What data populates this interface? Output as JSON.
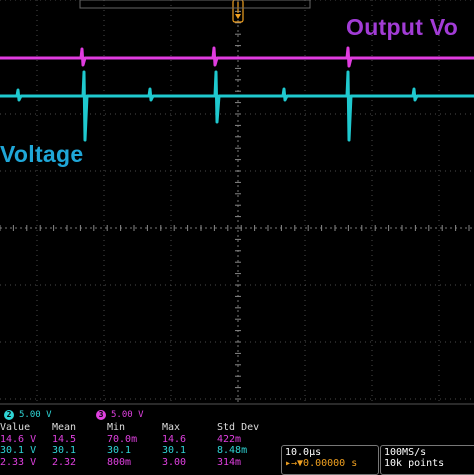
{
  "labels": {
    "output": "Output Vo",
    "input": "Voltage"
  },
  "channels": [
    {
      "num": "2",
      "scale": "5.00 V",
      "color": "#2fd6d6"
    },
    {
      "num": "3",
      "scale": "5.00 V",
      "color": "#e040e0"
    }
  ],
  "measurements": {
    "headers": [
      "Value",
      "Mean",
      "Min",
      "Max",
      "Std Dev"
    ],
    "rows": [
      {
        "color": "#e040e0",
        "cells": [
          "14.6 V",
          "14.5",
          "70.0m",
          "14.6",
          "422m"
        ]
      },
      {
        "color": "#2fd6d6",
        "cells": [
          "30.1 V",
          "30.1",
          "30.1",
          "30.1",
          "8.48m"
        ]
      },
      {
        "color": "#e040e0",
        "cells": [
          "2.33 V",
          "2.32",
          "800m",
          "3.00",
          "314m"
        ]
      }
    ]
  },
  "timebase": {
    "scale": "10.0µs",
    "position": "▸→▼0.00000 s"
  },
  "acquisition": {
    "rate": "100MS/s",
    "record": "10k points"
  },
  "colors": {
    "output_trace": "#e13ce0",
    "input_trace": "#1fc9cf",
    "grid": "#4a4a4a",
    "output_label": "#a23cd6",
    "input_label": "#1fa7d8",
    "trigger_marker": "#f0a020"
  }
}
